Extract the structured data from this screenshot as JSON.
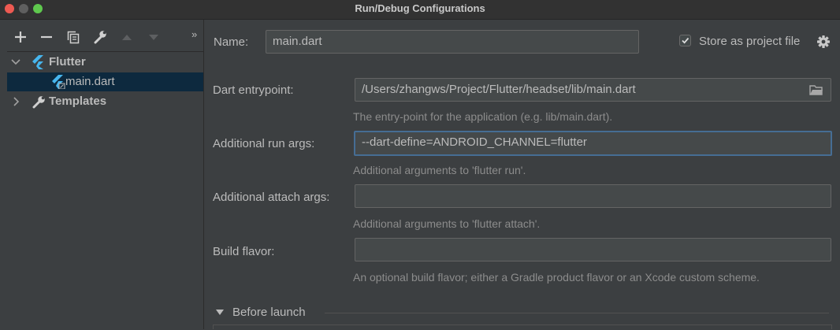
{
  "window": {
    "title": "Run/Debug Configurations"
  },
  "toolbar": {
    "buttons": [
      "add-icon",
      "remove-icon",
      "copy-icon",
      "wrench-icon",
      "move-up-icon",
      "move-down-icon",
      "more-icon"
    ],
    "more_label": "»"
  },
  "tree": {
    "flutter_label": "Flutter",
    "main_dart_label": "main.dart",
    "templates_label": "Templates"
  },
  "form": {
    "name_label": "Name:",
    "name_value": "main.dart",
    "store_label": "Store as project file",
    "store_checked": true,
    "entrypoint_label": "Dart entrypoint:",
    "entrypoint_value": "/Users/zhangws/Project/Flutter/headset/lib/main.dart",
    "entrypoint_hint": "The entry-point for the application (e.g. lib/main.dart).",
    "run_args_label": "Additional run args:",
    "run_args_value": "--dart-define=ANDROID_CHANNEL=flutter",
    "run_args_hint": "Additional arguments to 'flutter run'.",
    "attach_args_label": "Additional attach args:",
    "attach_args_value": "",
    "attach_args_hint": "Additional arguments to 'flutter attach'.",
    "build_flavor_label": "Build flavor:",
    "build_flavor_value": "",
    "build_flavor_hint": "An optional build flavor; either a Gradle product flavor or an Xcode custom scheme.",
    "before_launch_label": "Before launch"
  },
  "colors": {
    "background": "#3c3f41",
    "selection": "#0d293e",
    "focus_border": "#466d94",
    "flutter_blue": "#47b6ee"
  }
}
